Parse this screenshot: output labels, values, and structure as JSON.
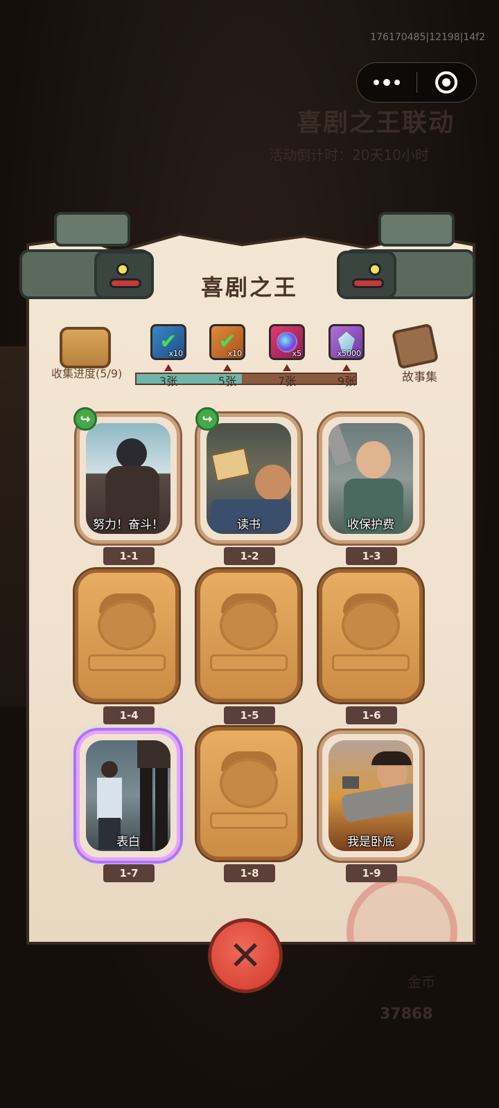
{
  "system": {
    "debug_text": "176170485|12198|14f2",
    "capsule": {
      "more_icon": "more-dots-icon",
      "close_icon": "target-circle-icon"
    }
  },
  "background": {
    "event_title": "喜剧之王联动",
    "countdown": "活动倒计时：20天10小时",
    "coin_label": "金币",
    "coin_count": "37868"
  },
  "modal": {
    "title": "喜剧之王",
    "collection": {
      "label": "收集进度(5/9)",
      "collected": 5,
      "total": 9,
      "icon": "card-pack-icon"
    },
    "story": {
      "label": "故事集",
      "icon": "story-book-icon"
    },
    "rewards": [
      {
        "icon": "blue-check-ticket-icon",
        "qty": "x10",
        "milestone": "3张"
      },
      {
        "icon": "orange-check-ticket-icon",
        "qty": "x10",
        "milestone": "5张"
      },
      {
        "icon": "portal-orb-icon",
        "qty": "x5",
        "milestone": "7张"
      },
      {
        "icon": "diamond-icon",
        "qty": "x5000",
        "milestone": "9张"
      }
    ],
    "cards": [
      {
        "id": "1-1",
        "title": "努力！奋斗！",
        "unlocked": true,
        "share": true
      },
      {
        "id": "1-2",
        "title": "读书",
        "unlocked": true,
        "share": true
      },
      {
        "id": "1-3",
        "title": "收保护费",
        "unlocked": true,
        "share": false
      },
      {
        "id": "1-4",
        "title": "",
        "unlocked": false,
        "share": false
      },
      {
        "id": "1-5",
        "title": "",
        "unlocked": false,
        "share": false
      },
      {
        "id": "1-6",
        "title": "",
        "unlocked": false,
        "share": false
      },
      {
        "id": "1-7",
        "title": "表白",
        "unlocked": true,
        "share": false,
        "rare": true
      },
      {
        "id": "1-8",
        "title": "",
        "unlocked": false,
        "share": false
      },
      {
        "id": "1-9",
        "title": "我是卧底",
        "unlocked": true,
        "share": false
      }
    ],
    "close_icon": "close-x-icon"
  }
}
